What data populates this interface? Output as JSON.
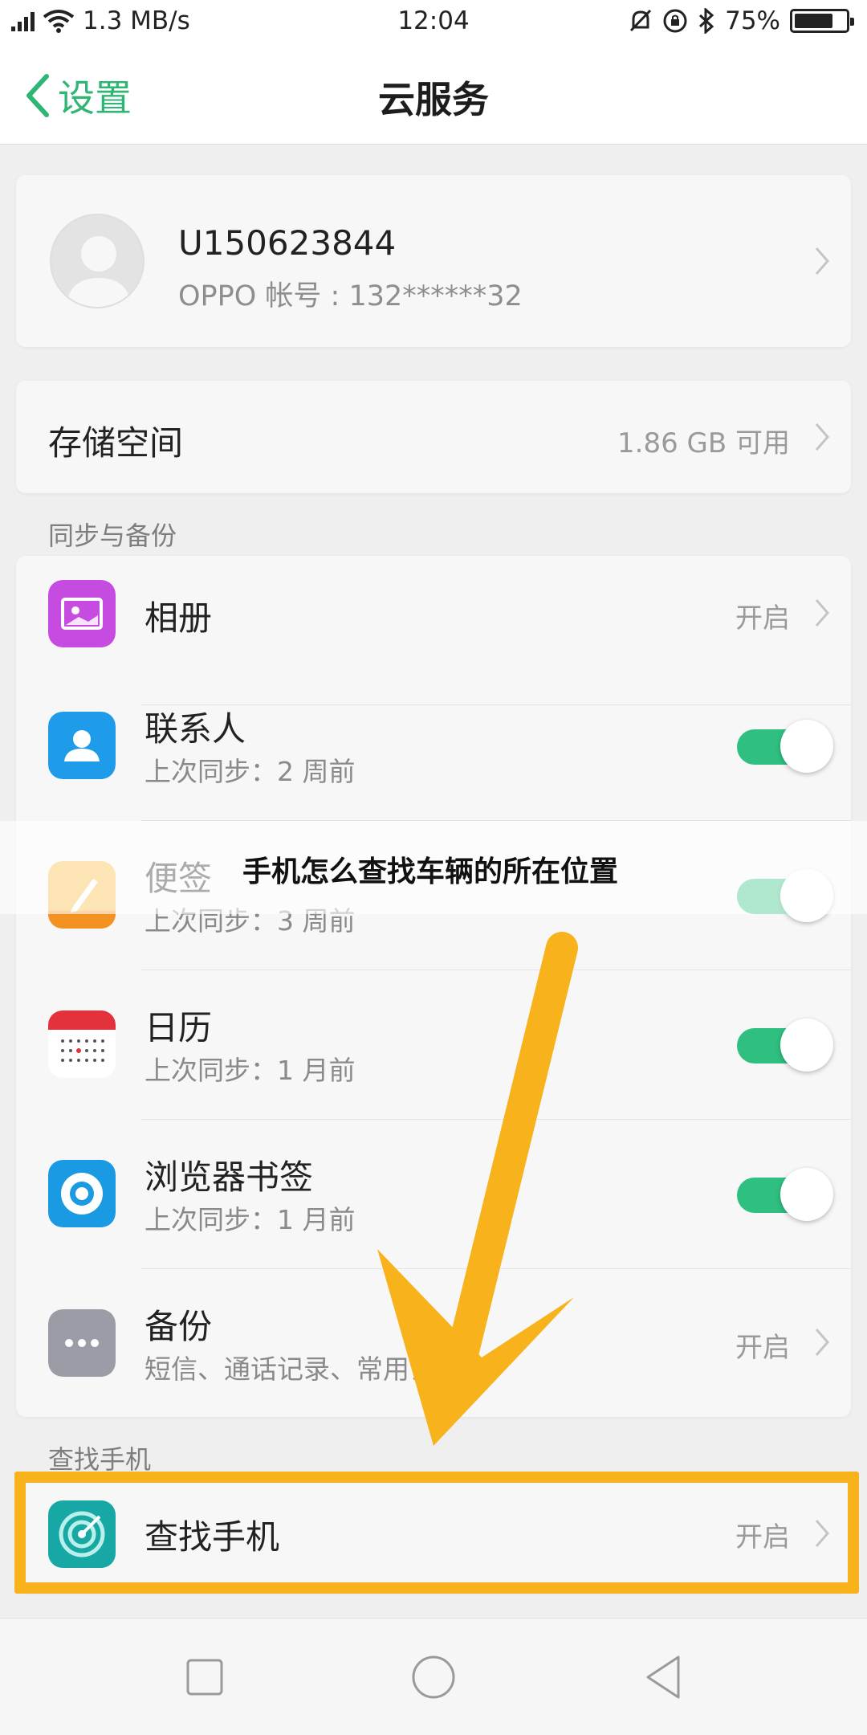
{
  "status_bar": {
    "net_speed": "1.3 MB/s",
    "time": "12:04",
    "battery_percent": "75%",
    "battery_level": 0.75,
    "icons": [
      "signal-icon",
      "wifi-icon",
      "mute-icon",
      "rotation-lock-icon",
      "bluetooth-icon",
      "battery-icon"
    ]
  },
  "header": {
    "back_label": "设置",
    "title": "云服务"
  },
  "account": {
    "username": "U150623844",
    "account_line": "OPPO 帐号 : 132******32"
  },
  "storage": {
    "label": "存储空间",
    "value": "1.86 GB 可用"
  },
  "sync_section": {
    "header": "同步与备份",
    "items": [
      {
        "title": "相册",
        "status": "开启",
        "icon": "album-icon",
        "color": "#c64be0"
      },
      {
        "title": "联系人",
        "subtitle": "上次同步：2 周前",
        "toggle": true,
        "icon": "contacts-icon",
        "color": "#1e9be9"
      },
      {
        "title": "便签",
        "subtitle": "上次同步：3 周前",
        "toggle": true,
        "icon": "notes-icon",
        "color": "#f7b73a"
      },
      {
        "title": "日历",
        "subtitle": "上次同步：1 月前",
        "toggle": true,
        "icon": "calendar-icon",
        "color": "#e3323b"
      },
      {
        "title": "浏览器书签",
        "subtitle": "上次同步：1 月前",
        "toggle": true,
        "icon": "browser-bookmark-icon",
        "color": "#1b9ae4"
      },
      {
        "title": "备份",
        "subtitle": "短信、通话记录、常用设置等",
        "status": "开启",
        "icon": "backup-icon",
        "color": "#9c9ca6"
      }
    ]
  },
  "find_section": {
    "header": "查找手机",
    "item": {
      "title": "查找手机",
      "status": "开启",
      "icon": "find-phone-icon",
      "color": "#17a7a4"
    }
  },
  "overlay": {
    "banner_text": "手机怎么查找车辆的所在位置",
    "highlight_color": "#f7b21c"
  },
  "accent_color": "#2fb574",
  "toggle_on_color": "#2fbf80"
}
